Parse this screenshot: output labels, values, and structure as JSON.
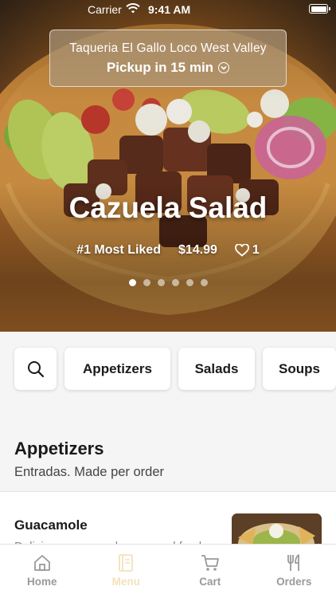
{
  "status_bar": {
    "carrier": "Carrier",
    "time": "9:41 AM"
  },
  "location": {
    "name": "Taqueria El Gallo Loco West Valley",
    "pickup": "Pickup in 15 min"
  },
  "featured": {
    "title": "Cazuela Salad",
    "badge": "#1 Most Liked",
    "price": "$14.99",
    "likes": "1",
    "slide_count": 6,
    "active_slide": 1
  },
  "categories": [
    "Appetizers",
    "Salads",
    "Soups"
  ],
  "section": {
    "title": "Appetizers",
    "subtitle": "Entradas. Made per order"
  },
  "menu_item": {
    "name": "Guacamole",
    "description": "Delicious guacamole prepared fresh"
  },
  "tabs": [
    {
      "label": "Home",
      "icon": "home-icon",
      "active": false
    },
    {
      "label": "Menu",
      "icon": "menu-book-icon",
      "active": true
    },
    {
      "label": "Cart",
      "icon": "cart-icon",
      "active": false
    },
    {
      "label": "Orders",
      "icon": "fork-knife-icon",
      "active": false
    }
  ],
  "colors": {
    "active_tab": "#f3e2bb",
    "inactive_tab": "#9a9a9a"
  }
}
